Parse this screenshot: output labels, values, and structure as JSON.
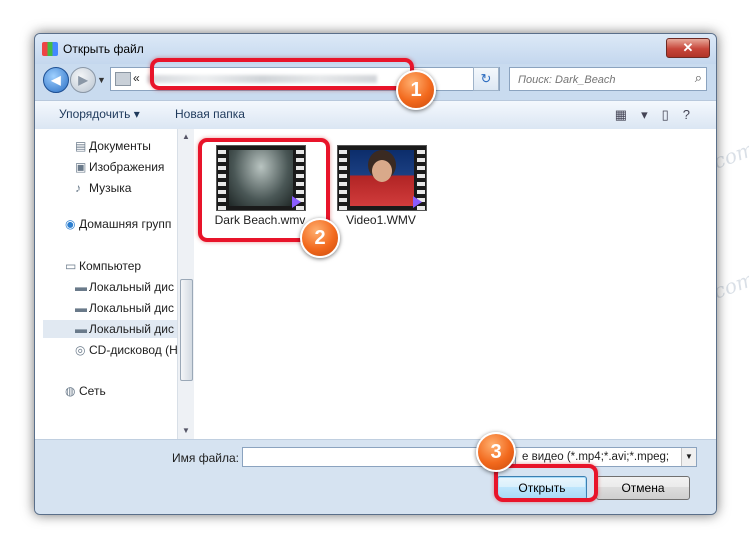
{
  "window": {
    "title": "Открыть файл",
    "close_glyph": "✕"
  },
  "nav": {
    "back_glyph": "◀",
    "forward_glyph": "▶",
    "address_prefix": "«",
    "search_placeholder": "Поиск: Dark_Beach",
    "refresh_glyph": "↻"
  },
  "toolbar": {
    "organize_label": "Упорядочить ▾",
    "new_folder_label": "Новая папка"
  },
  "sidebar": {
    "items": [
      {
        "label": "Документы",
        "icon": "documents-icon"
      },
      {
        "label": "Изображения",
        "icon": "pictures-icon"
      },
      {
        "label": "Музыка",
        "icon": "music-icon"
      },
      {
        "label": "Домашняя групп",
        "icon": "homegroup-icon"
      },
      {
        "label": "Компьютер",
        "icon": "computer-icon"
      },
      {
        "label": "Локальный дис",
        "icon": "disk-icon"
      },
      {
        "label": "Локальный дис",
        "icon": "disk-icon"
      },
      {
        "label": "Локальный дис",
        "icon": "disk-icon"
      },
      {
        "label": "CD-дисковод (H",
        "icon": "cd-icon"
      },
      {
        "label": "Сеть",
        "icon": "network-icon"
      }
    ]
  },
  "files": [
    {
      "name": "Dark Beach.wmv",
      "thumbnail": "beach-thumbnail"
    },
    {
      "name": "Video1.WMV",
      "thumbnail": "news-thumbnail"
    }
  ],
  "bottom": {
    "filename_label": "Имя файла:",
    "filename_value": "",
    "filetype_value": "е видео (*.mp4;*.avi;*.mpeg;",
    "open_label": "Открыть",
    "cancel_label": "Отмена"
  },
  "annotations": {
    "badge1": "1",
    "badge2": "2",
    "badge3": "3",
    "highlight_color": "#e8142a",
    "badge_color": "#f2691d"
  },
  "watermark": {
    "text": "Soringpcrepair.com"
  }
}
